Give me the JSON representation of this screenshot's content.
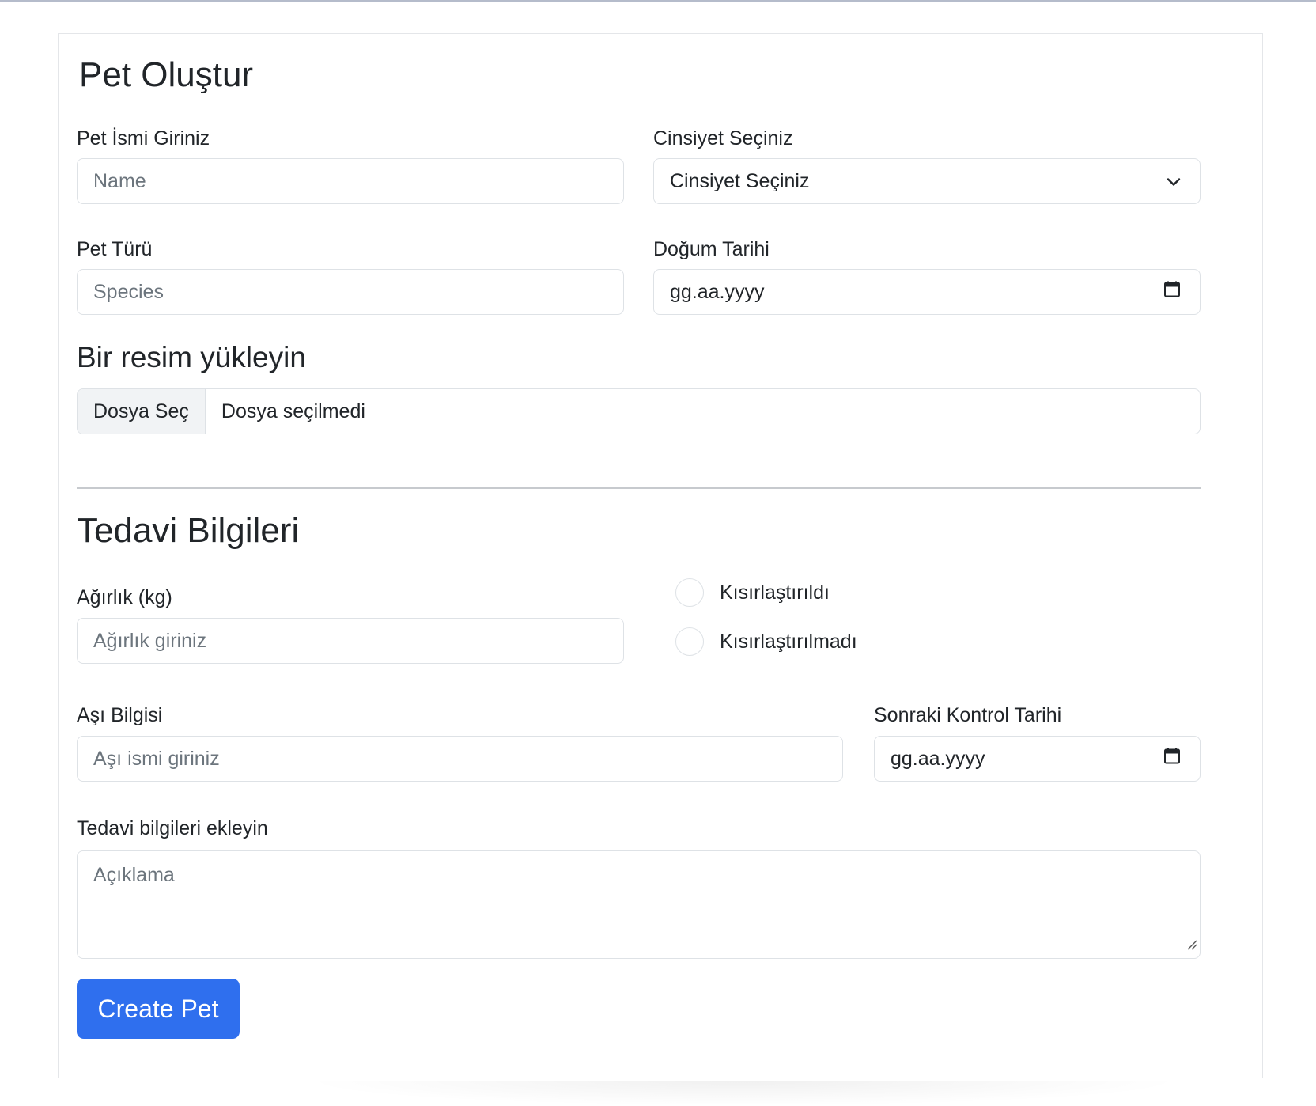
{
  "form": {
    "title": "Pet Oluştur",
    "pet_name": {
      "label": "Pet İsmi Giriniz",
      "placeholder": "Name"
    },
    "gender": {
      "label": "Cinsiyet Seçiniz",
      "selected": "Cinsiyet Seçiniz",
      "icon": "chevron-down-icon"
    },
    "species": {
      "label": "Pet Türü",
      "placeholder": "Species"
    },
    "birth_date": {
      "label": "Doğum Tarihi",
      "value": "gg.aa.yyyy",
      "icon": "calendar-icon"
    },
    "image_upload": {
      "heading": "Bir resim yükleyin",
      "button": "Dosya Seç",
      "status": "Dosya seçilmedi"
    }
  },
  "treatment": {
    "heading": "Tedavi Bilgileri",
    "weight": {
      "label": "Ağırlık (kg)",
      "placeholder": "Ağırlık giriniz"
    },
    "neutered_options": [
      "Kısırlaştırıldı",
      "Kısırlaştırılmadı"
    ],
    "vaccine": {
      "label": "Aşı Bilgisi",
      "placeholder": "Aşı ismi giriniz"
    },
    "next_checkup": {
      "label": "Sonraki Kontrol Tarihi",
      "value": "gg.aa.yyyy",
      "icon": "calendar-icon"
    },
    "notes": {
      "label": "Tedavi bilgileri ekleyin",
      "placeholder": "Açıklama"
    }
  },
  "submit": {
    "label": "Create Pet"
  },
  "colors": {
    "primary": "#2f6fee",
    "border": "#dee2e6",
    "placeholder": "#6c757d",
    "text": "#212529"
  }
}
